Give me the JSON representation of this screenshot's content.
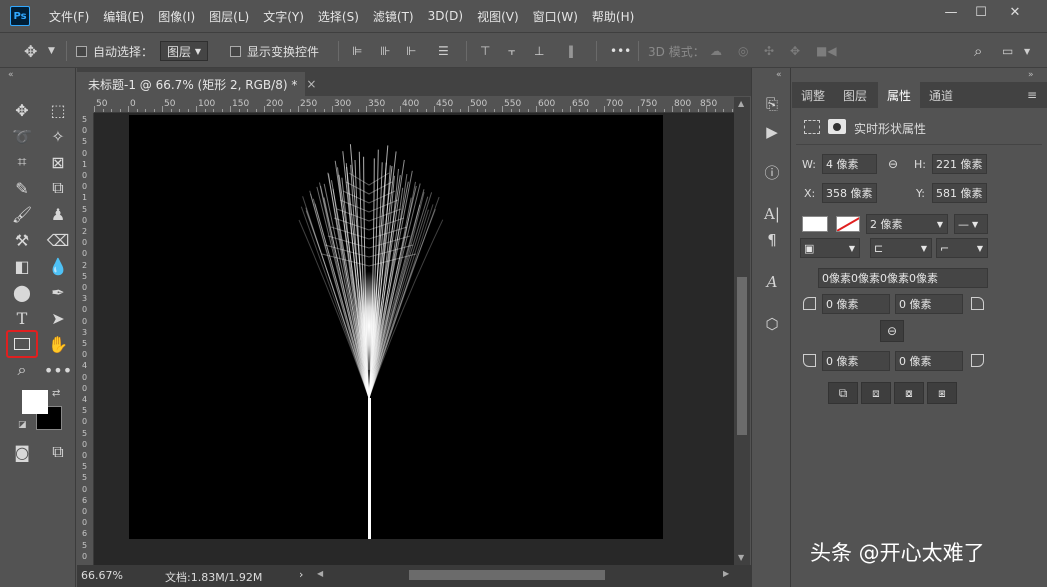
{
  "app": {
    "logo": "Ps"
  },
  "menu": [
    "文件(F)",
    "编辑(E)",
    "图像(I)",
    "图层(L)",
    "文字(Y)",
    "选择(S)",
    "滤镜(T)",
    "3D(D)",
    "视图(V)",
    "窗口(W)",
    "帮助(H)"
  ],
  "window_controls": {
    "minimize": "—",
    "maximize": "☐",
    "close": "✕"
  },
  "options": {
    "auto_select_label": "自动选择：",
    "auto_select_value": "图层",
    "show_transform_label": "显示变换控件",
    "more": "•••",
    "mode_3d_label": "3D 模式："
  },
  "document": {
    "tab_title": "未标题-1 @ 66.7% (矩形 2, RGB/8) *",
    "tab_close": "×",
    "zoom": "66.67%",
    "doc_info": "文档:1.83M/1.92M",
    "status_arrow": "›"
  },
  "ruler": {
    "top": [
      "50",
      "0",
      "50",
      "100",
      "150",
      "200",
      "250",
      "300",
      "350",
      "400",
      "450",
      "500",
      "550",
      "600",
      "650",
      "700",
      "750",
      "800",
      "850"
    ],
    "left": [
      "5",
      "0",
      "5",
      "0",
      "1",
      "0",
      "0",
      "1",
      "5",
      "0",
      "2",
      "0",
      "0",
      "2",
      "5",
      "0",
      "3",
      "0",
      "0",
      "3",
      "5",
      "0",
      "4",
      "0",
      "0",
      "4",
      "5",
      "0",
      "5",
      "0",
      "0",
      "5",
      "5",
      "0",
      "6",
      "0",
      "0",
      "6",
      "5",
      "0"
    ]
  },
  "panel": {
    "tabs": [
      "调整",
      "图层",
      "属性",
      "通道"
    ],
    "active_tab": "属性",
    "title": "实时形状属性",
    "w_label": "W:",
    "w_value": "4 像素",
    "h_label": "H:",
    "h_value": "221 像素",
    "x_label": "X:",
    "x_value": "358 像素",
    "y_label": "Y:",
    "y_value": "581 像素",
    "stroke_width": "2 像素",
    "radius_all": "0像素0像素0像素0像素",
    "radius_tl": "0 像素",
    "radius_tr": "0 像素",
    "radius_bl": "0 像素",
    "radius_br": "0 像素"
  },
  "watermark": "头条 @开心太难了",
  "colors": {
    "bg": "#535353",
    "canvas": "#000000",
    "accent": "#e02020"
  }
}
